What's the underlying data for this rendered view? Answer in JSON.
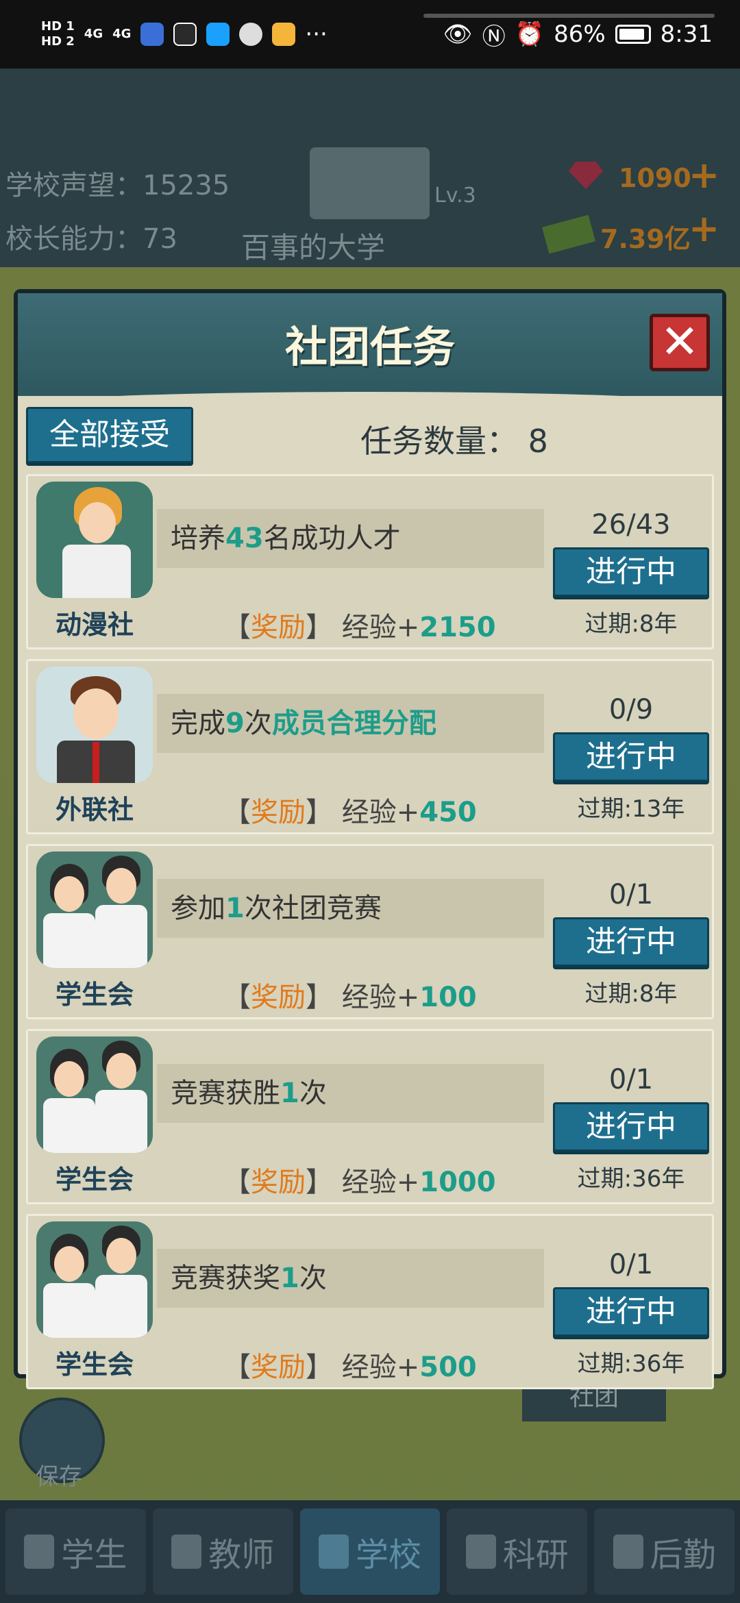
{
  "statusbar": {
    "hd1": "HD 1",
    "hd2": "HD 2",
    "sig1": "4G",
    "sig2": "4G",
    "more": "···",
    "battery": "86%",
    "time": "8:31"
  },
  "game": {
    "reputation_label": "学校声望：15235",
    "principal_label": "校长能力：73",
    "school_name": "百事的大学",
    "level": "Lv.3",
    "gems": "1090",
    "money": "7.39亿",
    "save": "保存",
    "club_tab": "社团"
  },
  "nav": [
    {
      "label": "学生"
    },
    {
      "label": "教师"
    },
    {
      "label": "学校"
    },
    {
      "label": "科研"
    },
    {
      "label": "后勤"
    }
  ],
  "modal": {
    "title": "社团任务",
    "close": "✕",
    "accept_all": "全部接受",
    "task_count": "任务数量：  8",
    "tasks": [
      {
        "club": "动漫社",
        "desc_pre": "培养",
        "desc_hl": "43",
        "desc_mid": "名成功人才",
        "desc_hl2": "",
        "progress": "26/43",
        "status": "进行中",
        "expire": "过期:8年",
        "reward_label": "奖励",
        "reward_pre": "经验+",
        "reward_val": "2150"
      },
      {
        "club": "外联社",
        "desc_pre": "完成",
        "desc_hl": "9",
        "desc_mid": "次",
        "desc_hl2": "成员合理分配",
        "progress": "0/9",
        "status": "进行中",
        "expire": "过期:13年",
        "reward_label": "奖励",
        "reward_pre": "经验+",
        "reward_val": "450"
      },
      {
        "club": "学生会",
        "desc_pre": "参加",
        "desc_hl": "1",
        "desc_mid": "次社团竞赛",
        "desc_hl2": "",
        "progress": "0/1",
        "status": "进行中",
        "expire": "过期:8年",
        "reward_label": "奖励",
        "reward_pre": "经验+",
        "reward_val": "100"
      },
      {
        "club": "学生会",
        "desc_pre": "竞赛获胜",
        "desc_hl": "1",
        "desc_mid": "次",
        "desc_hl2": "",
        "progress": "0/1",
        "status": "进行中",
        "expire": "过期:36年",
        "reward_label": "奖励",
        "reward_pre": "经验+",
        "reward_val": "1000"
      },
      {
        "club": "学生会",
        "desc_pre": "竞赛获奖",
        "desc_hl": "1",
        "desc_mid": "次",
        "desc_hl2": "",
        "progress": "0/1",
        "status": "进行中",
        "expire": "过期:36年",
        "reward_label": "奖励",
        "reward_pre": "经验+",
        "reward_val": "500"
      }
    ]
  }
}
